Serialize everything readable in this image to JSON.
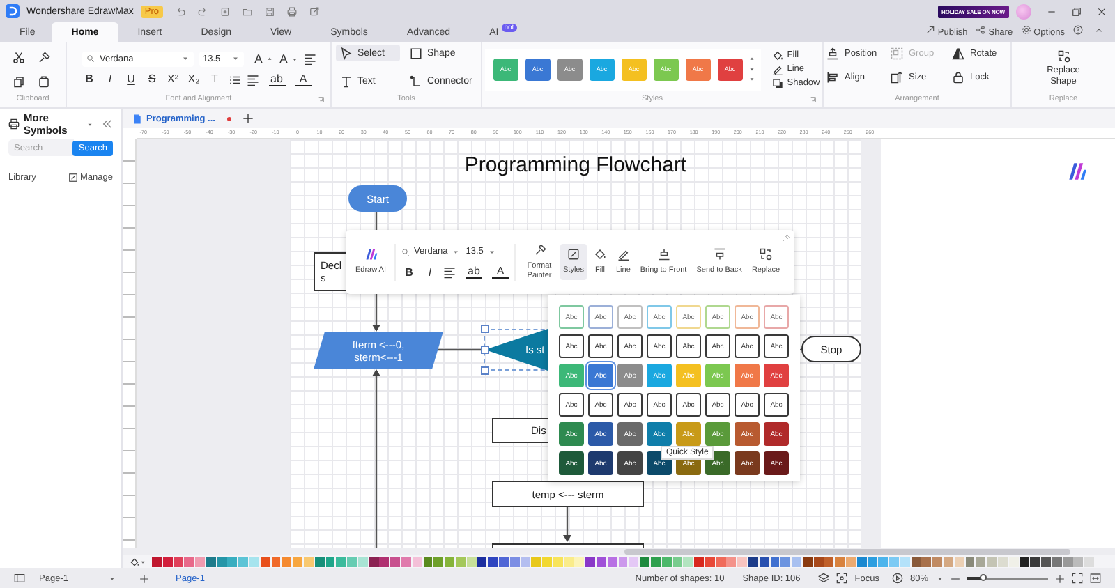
{
  "title_bar": {
    "app_name": "Wondershare EdrawMax",
    "edition": "Pro",
    "promo": "HOLIDAY SALE ON NOW"
  },
  "menu_tabs": [
    {
      "label": "File",
      "selected": false
    },
    {
      "label": "Home",
      "selected": true
    },
    {
      "label": "Insert",
      "selected": false
    },
    {
      "label": "Design",
      "selected": false
    },
    {
      "label": "View",
      "selected": false
    },
    {
      "label": "Symbols",
      "selected": false
    },
    {
      "label": "Advanced",
      "selected": false
    },
    {
      "label": "AI",
      "selected": false,
      "badge": "hot"
    }
  ],
  "top_actions": [
    "Publish",
    "Share",
    "Options"
  ],
  "ribbon": {
    "clipboard": {
      "title": "Clipboard"
    },
    "font": {
      "title": "Font and Alignment",
      "family": "Verdana",
      "size": "13.5",
      "size_glyphs": [
        "A",
        "A"
      ],
      "format_buttons": [
        {
          "glyph": "B",
          "disabled": false
        },
        {
          "glyph": "I",
          "disabled": false
        },
        {
          "glyph": "U",
          "disabled": false
        },
        {
          "glyph": "S",
          "disabled": false
        },
        {
          "glyph": "X²",
          "disabled": false
        },
        {
          "glyph": "X₂",
          "disabled": false
        },
        {
          "glyph": "T",
          "disabled": true
        }
      ],
      "color_glyphs": [
        "ab",
        "A"
      ]
    },
    "tools": {
      "title": "Tools",
      "items": [
        {
          "label": "Select",
          "selected": true
        },
        {
          "label": "Shape",
          "selected": false
        },
        {
          "label": "Text",
          "selected": false
        },
        {
          "label": "Connector",
          "selected": false
        }
      ]
    },
    "styles": {
      "title": "Styles",
      "swatches": [
        {
          "label": "Abc",
          "color": "#3cb878"
        },
        {
          "label": "Abc",
          "color": "#3a78d4"
        },
        {
          "label": "Abc",
          "color": "#8c8c8c"
        },
        {
          "label": "Abc",
          "color": "#1aa8e0"
        },
        {
          "label": "Abc",
          "color": "#f4c020"
        },
        {
          "label": "Abc",
          "color": "#7cc850"
        },
        {
          "label": "Abc",
          "color": "#f07848"
        },
        {
          "label": "Abc",
          "color": "#e04040"
        }
      ],
      "options": [
        "Fill",
        "Line",
        "Shadow"
      ]
    },
    "arrangement": {
      "title": "Arrangement",
      "items": [
        {
          "label": "Position",
          "disabled": false
        },
        {
          "label": "Align",
          "disabled": false
        },
        {
          "label": "Group",
          "disabled": true
        },
        {
          "label": "Size",
          "disabled": false
        },
        {
          "label": "Rotate",
          "disabled": false
        },
        {
          "label": "Lock",
          "disabled": false
        }
      ]
    },
    "replace": {
      "title": "Replace",
      "label": "Replace Shape"
    }
  },
  "symbols_panel": {
    "title": "More Symbols",
    "search": {
      "placeholder": "Search",
      "button": "Search"
    },
    "library": "Library",
    "manage": "Manage"
  },
  "document_tab": {
    "label": "Programming ...",
    "unsaved": true
  },
  "ruler_labels": [
    "-70",
    "-60",
    "-50",
    "-40",
    "-30",
    "-20",
    "-10",
    "0",
    "10",
    "20",
    "30",
    "40",
    "50",
    "60",
    "70",
    "80",
    "90",
    "100",
    "110",
    "120",
    "130",
    "140",
    "150",
    "160",
    "170",
    "180",
    "190",
    "200",
    "210",
    "220",
    "230",
    "240",
    "250",
    "260"
  ],
  "flowchart": {
    "title": "Programming Flowchart",
    "shapes": [
      {
        "kind": "terminator",
        "color": "#4a86d8",
        "lines": [
          "Start"
        ]
      },
      {
        "kind": "process",
        "lines": [
          "Decl",
          "s"
        ]
      },
      {
        "kind": "data",
        "color": "#4a86d8",
        "lines": [
          "fterm <---0,",
          "sterm<---1"
        ]
      },
      {
        "kind": "decision",
        "color": "#0b7aa0",
        "lines": [
          "Is st"
        ]
      },
      {
        "kind": "terminator",
        "color": "#ffffff",
        "lines": [
          "Stop"
        ]
      },
      {
        "kind": "process",
        "lines": [
          "Dis"
        ]
      },
      {
        "kind": "process",
        "lines": [
          "temp <--- sterm"
        ]
      },
      {
        "kind": "process"
      }
    ]
  },
  "floating_toolbar": {
    "ai_label": "Edraw AI",
    "family": "Verdana",
    "size": "13.5",
    "format_glyphs": [
      "B",
      "I"
    ],
    "color_glyphs": [
      "ab",
      "A"
    ],
    "tools": [
      {
        "label": "Format Painter",
        "selected": false
      },
      {
        "label": "Styles",
        "selected": true
      },
      {
        "label": "Fill",
        "selected": false
      },
      {
        "label": "Line",
        "selected": false
      },
      {
        "label": "Bring to Front",
        "selected": false
      },
      {
        "label": "Send to Back",
        "selected": false
      },
      {
        "label": "Replace",
        "selected": false
      }
    ]
  },
  "quick_styles": {
    "tooltip": "Quick Style",
    "rows": [
      {
        "kind": "outline-light",
        "cells": [
          {
            "label": "Abc",
            "color": "#7fc8a0",
            "selected": false
          },
          {
            "label": "Abc",
            "color": "#9cb0d8",
            "selected": false
          },
          {
            "label": "Abc",
            "color": "#c0c0c0",
            "selected": false
          },
          {
            "label": "Abc",
            "color": "#80c8e8",
            "selected": false
          },
          {
            "label": "Abc",
            "color": "#f0d890",
            "selected": false
          },
          {
            "label": "Abc",
            "color": "#b0d890",
            "selected": false
          },
          {
            "label": "Abc",
            "color": "#f0b898",
            "selected": false
          },
          {
            "label": "Abc",
            "color": "#e8a8a8",
            "selected": false
          }
        ]
      },
      {
        "kind": "outline",
        "cells": [
          {
            "label": "Abc",
            "color": "#3a3a3a",
            "selected": false
          },
          {
            "label": "Abc",
            "color": "#3a3a3a",
            "selected": false
          },
          {
            "label": "Abc",
            "color": "#3a3a3a",
            "selected": false
          },
          {
            "label": "Abc",
            "color": "#3a3a3a",
            "selected": false
          },
          {
            "label": "Abc",
            "color": "#3a3a3a",
            "selected": false
          },
          {
            "label": "Abc",
            "color": "#3a3a3a",
            "selected": false
          },
          {
            "label": "Abc",
            "color": "#3a3a3a",
            "selected": false
          },
          {
            "label": "Abc",
            "color": "#3a3a3a",
            "selected": false
          }
        ]
      },
      {
        "kind": "filled",
        "cells": [
          {
            "label": "Abc",
            "color": "#3cb878",
            "selected": false
          },
          {
            "label": "Abc",
            "color": "#3a78d4",
            "selected": true
          },
          {
            "label": "Abc",
            "color": "#8c8c8c",
            "selected": false
          },
          {
            "label": "Abc",
            "color": "#1aa8e0",
            "selected": false
          },
          {
            "label": "Abc",
            "color": "#f4c020",
            "selected": false
          },
          {
            "label": "Abc",
            "color": "#7cc850",
            "selected": false
          },
          {
            "label": "Abc",
            "color": "#f07848",
            "selected": false
          },
          {
            "label": "Abc",
            "color": "#e04040",
            "selected": false
          }
        ]
      },
      {
        "kind": "outline-bold",
        "cells": [
          {
            "label": "Abc",
            "color": "#3a3a3a",
            "selected": false
          },
          {
            "label": "Abc",
            "color": "#3a3a3a",
            "selected": false
          },
          {
            "label": "Abc",
            "color": "#3a3a3a",
            "selected": false
          },
          {
            "label": "Abc",
            "color": "#3a3a3a",
            "selected": false
          },
          {
            "label": "Abc",
            "color": "#3a3a3a",
            "selected": false
          },
          {
            "label": "Abc",
            "color": "#3a3a3a",
            "selected": false
          },
          {
            "label": "Abc",
            "color": "#3a3a3a",
            "selected": false
          },
          {
            "label": "Abc",
            "color": "#3a3a3a",
            "selected": false
          }
        ]
      },
      {
        "kind": "filled",
        "cells": [
          {
            "label": "Abc",
            "color": "#2e8a50",
            "selected": false
          },
          {
            "label": "Abc",
            "color": "#2c5aa8",
            "selected": false
          },
          {
            "label": "Abc",
            "color": "#6a6a6a",
            "selected": false
          },
          {
            "label": "Abc",
            "color": "#0f7eaa",
            "selected": false
          },
          {
            "label": "Abc",
            "color": "#c89a18",
            "selected": false
          },
          {
            "label": "Abc",
            "color": "#5a9a3a",
            "selected": false
          },
          {
            "label": "Abc",
            "color": "#b85a30",
            "selected": false
          },
          {
            "label": "Abc",
            "color": "#b02a2a",
            "selected": false
          }
        ]
      },
      {
        "kind": "filled",
        "cells": [
          {
            "label": "Abc",
            "color": "#1e5a3a",
            "selected": false
          },
          {
            "label": "Abc",
            "color": "#1e3a6e",
            "selected": false
          },
          {
            "label": "Abc",
            "color": "#444444",
            "selected": false
          },
          {
            "label": "Abc",
            "color": "#0c4a6a",
            "selected": false
          },
          {
            "label": "Abc",
            "color": "#8a6a10",
            "selected": false
          },
          {
            "label": "Abc",
            "color": "#3a6a28",
            "selected": false
          },
          {
            "label": "Abc",
            "color": "#7a3a1e",
            "selected": false
          },
          {
            "label": "Abc",
            "color": "#6a1a1a",
            "selected": false
          }
        ]
      }
    ]
  },
  "palette": [
    {
      "color": "#c0172f"
    },
    {
      "color": "#d21f3c"
    },
    {
      "color": "#e0405a"
    },
    {
      "color": "#e8698a"
    },
    {
      "color": "#f09bb0"
    },
    {
      "color": "#1e7c8c"
    },
    {
      "color": "#2596a8"
    },
    {
      "color": "#38aec0"
    },
    {
      "color": "#5cc4d6"
    },
    {
      "color": "#a6e4ee"
    },
    {
      "color": "#e8501c"
    },
    {
      "color": "#f06a2a"
    },
    {
      "color": "#f58a30"
    },
    {
      "color": "#f7a640"
    },
    {
      "color": "#f8c870"
    },
    {
      "color": "#17907a"
    },
    {
      "color": "#1fa68a"
    },
    {
      "color": "#3bbb9c"
    },
    {
      "color": "#66ccb2"
    },
    {
      "color": "#a8e4d4"
    },
    {
      "color": "#8b2252"
    },
    {
      "color": "#b03070"
    },
    {
      "color": "#c8508e"
    },
    {
      "color": "#e07aac"
    },
    {
      "color": "#f4c0d8"
    },
    {
      "color": "#5a8a1e"
    },
    {
      "color": "#6ea02a"
    },
    {
      "color": "#86b43a"
    },
    {
      "color": "#a4c85a"
    },
    {
      "color": "#c8e09a"
    },
    {
      "color": "#1c2ea0"
    },
    {
      "color": "#2e44c0"
    },
    {
      "color": "#5066d6"
    },
    {
      "color": "#7c8ee4"
    },
    {
      "color": "#b4bef0"
    },
    {
      "color": "#e8c81a"
    },
    {
      "color": "#f2d830"
    },
    {
      "color": "#f8e45a"
    },
    {
      "color": "#faec8a"
    },
    {
      "color": "#fcf4b8"
    },
    {
      "color": "#8a38c8"
    },
    {
      "color": "#a050d8"
    },
    {
      "color": "#b870e4"
    },
    {
      "color": "#cc98ec"
    },
    {
      "color": "#e4c8f6"
    },
    {
      "color": "#1e8a3e"
    },
    {
      "color": "#2ea04e"
    },
    {
      "color": "#4cb86a"
    },
    {
      "color": "#78cc8e"
    },
    {
      "color": "#b2e4c0"
    },
    {
      "color": "#d8281e"
    },
    {
      "color": "#e84838"
    },
    {
      "color": "#f06a5a"
    },
    {
      "color": "#f4928a"
    },
    {
      "color": "#f8c4c0"
    },
    {
      "color": "#1c3c8a"
    },
    {
      "color": "#2850b0"
    },
    {
      "color": "#4070d0"
    },
    {
      "color": "#6c94e0"
    },
    {
      "color": "#a8c0f0"
    },
    {
      "color": "#8a3a10"
    },
    {
      "color": "#a8481a"
    },
    {
      "color": "#c0602a"
    },
    {
      "color": "#d8823e"
    },
    {
      "color": "#ecaa70"
    },
    {
      "color": "#1a88d0"
    },
    {
      "color": "#2c9ee0"
    },
    {
      "color": "#4cb4ec"
    },
    {
      "color": "#7ccaf4"
    },
    {
      "color": "#b4e2fa"
    },
    {
      "color": "#8a5a3a"
    },
    {
      "color": "#a8704a"
    },
    {
      "color": "#c08a62"
    },
    {
      "color": "#d4a882"
    },
    {
      "color": "#ecd0b4"
    },
    {
      "color": "#8a8a7a"
    },
    {
      "color": "#a8a898"
    },
    {
      "color": "#c4c4b4"
    },
    {
      "color": "#dcdcd0"
    },
    {
      "color": "#f0f0e8"
    },
    {
      "color": "#222222"
    },
    {
      "color": "#3a3a3a"
    },
    {
      "color": "#555555"
    },
    {
      "color": "#777777"
    },
    {
      "color": "#999999"
    },
    {
      "color": "#bbbbbb"
    },
    {
      "color": "#dddddd"
    }
  ],
  "status_bar": {
    "page_select": "Page-1",
    "pages": [
      {
        "label": "Page-1",
        "selected": true
      }
    ],
    "shape_count": "Number of shapes: 10",
    "shape_id": "Shape ID: 106",
    "focus": "Focus",
    "zoom": "80%",
    "zoom_slider": {
      "level": 0.2
    }
  }
}
